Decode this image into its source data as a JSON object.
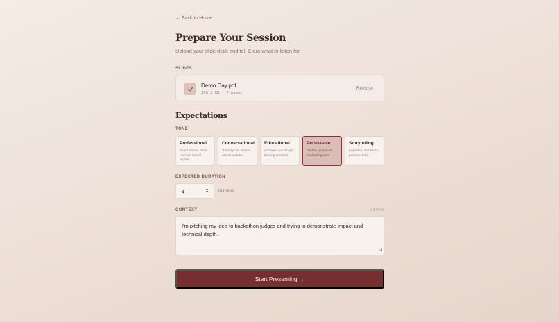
{
  "nav": {
    "back_label": "← Back to Home"
  },
  "header": {
    "title": "Prepare Your Session",
    "subtitle": "Upload your slide deck and tell Clara what to listen for."
  },
  "slides": {
    "label": "SLIDES",
    "file_name": "Demo Day.pdf",
    "file_meta": "298.2 KB · 7 pages",
    "remove_label": "Remove",
    "check_icon": "check-icon"
  },
  "expectations": {
    "heading": "Expectations",
    "tone_label": "TONE",
    "tones": [
      {
        "title": "Professional",
        "desc": "Board rooms, client reviews, formal reports",
        "selected": false
      },
      {
        "title": "Conversational",
        "desc": "Team syncs, demos, casual updates",
        "selected": false
      },
      {
        "title": "Educational",
        "desc": "Lectures, workshops, training sessions",
        "selected": false
      },
      {
        "title": "Persuasive",
        "desc": "Pitches, proposals, fundraising asks",
        "selected": true
      },
      {
        "title": "Storytelling",
        "desc": "Keynotes, narratives, personal talks",
        "selected": false
      }
    ],
    "duration_label": "EXPECTED DURATION",
    "duration_value": "4",
    "duration_unit": "minutes",
    "context_label": "CONTEXT",
    "context_counter": "94/500",
    "context_value": "I'm pitching my idea to hackathon judges and trying to demonstrate impact and technical depth."
  },
  "actions": {
    "start_label": "Start Presenting →"
  },
  "colors": {
    "accent": "#762e30",
    "background": "#f0e6df",
    "selected_tone": "#d9bdb6"
  }
}
